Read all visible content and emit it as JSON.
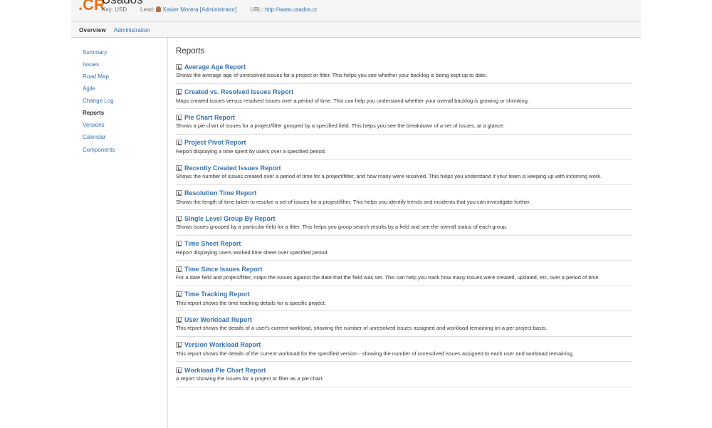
{
  "project": {
    "logo": ".CR",
    "title": "Usados",
    "key": "Key: USD",
    "lead_label": "Lead:",
    "lead": "Xavier Morera [Administrator]",
    "url_label": "URL:",
    "url": "http://www.usados.cr"
  },
  "nav": {
    "tabs": [
      {
        "label": "Overview",
        "active": true
      },
      {
        "label": "Administration"
      }
    ]
  },
  "sidebar": {
    "items": [
      {
        "label": "Summary"
      },
      {
        "label": "Issues"
      },
      {
        "label": "Road Map"
      },
      {
        "label": "Agile"
      },
      {
        "label": "Change Log"
      },
      {
        "label": "Reports",
        "active": true
      },
      {
        "label": "Versions"
      },
      {
        "label": "Calendar"
      },
      {
        "label": "Components"
      }
    ]
  },
  "main": {
    "title": "Reports",
    "reports": [
      {
        "title": "Average Age Report",
        "desc": "Shows the average age of unresolved issues for a project or filter. This helps you see whether your backlog is being kept up to date."
      },
      {
        "title": "Created vs. Resolved Issues Report",
        "desc": "Maps created issues versus resolved issues over a period of time. This can help you understand whether your overall backlog is growing or shrinking."
      },
      {
        "title": "Pie Chart Report",
        "desc": "Shows a pie chart of issues for a project/filter grouped by a specified field. This helps you see the breakdown of a set of issues, at a glance."
      },
      {
        "title": "Project Pivot Report",
        "desc": "Report displaying a time spent by users over a specified period."
      },
      {
        "title": "Recently Created Issues Report",
        "desc": "Shows the number of issues created over a period of time for a project/filter, and how many were resolved. This helps you understand if your team is keeping up with incoming work."
      },
      {
        "title": "Resolution Time Report",
        "desc": "Shows the length of time taken to resolve a set of issues for a project/filter. This helps you identify trends and incidents that you can investigate further."
      },
      {
        "title": "Single Level Group By Report",
        "desc": "Shows issues grouped by a particular field for a filter. This helps you group search results by a field and see the overall status of each group."
      },
      {
        "title": "Time Sheet Report",
        "desc": "Report displaying users worked time sheet over specified period."
      },
      {
        "title": "Time Since Issues Report",
        "desc": "For a date field and project/filter, maps the issues against the date that the field was set. This can help you track how many issues were created, updated, etc, over a period of time."
      },
      {
        "title": "Time Tracking Report",
        "desc": "This report shows the time tracking details for a specific project."
      },
      {
        "title": "User Workload Report",
        "desc": "This report shows the details of a user's current workload, showing the number of unresolved issues assigned and workload remaining on a per project basis."
      },
      {
        "title": "Version Workload Report",
        "desc": "This report shows the details of the current workload for the specified version - showing the number of unresolved issues assigned to each user and workload remaining."
      },
      {
        "title": "Workload Pie Chart Report",
        "desc": "A report showing the issues for a project or filter as a pie chart."
      }
    ]
  },
  "colors": {
    "link": "#3572b0",
    "logo": "#e8711a"
  }
}
